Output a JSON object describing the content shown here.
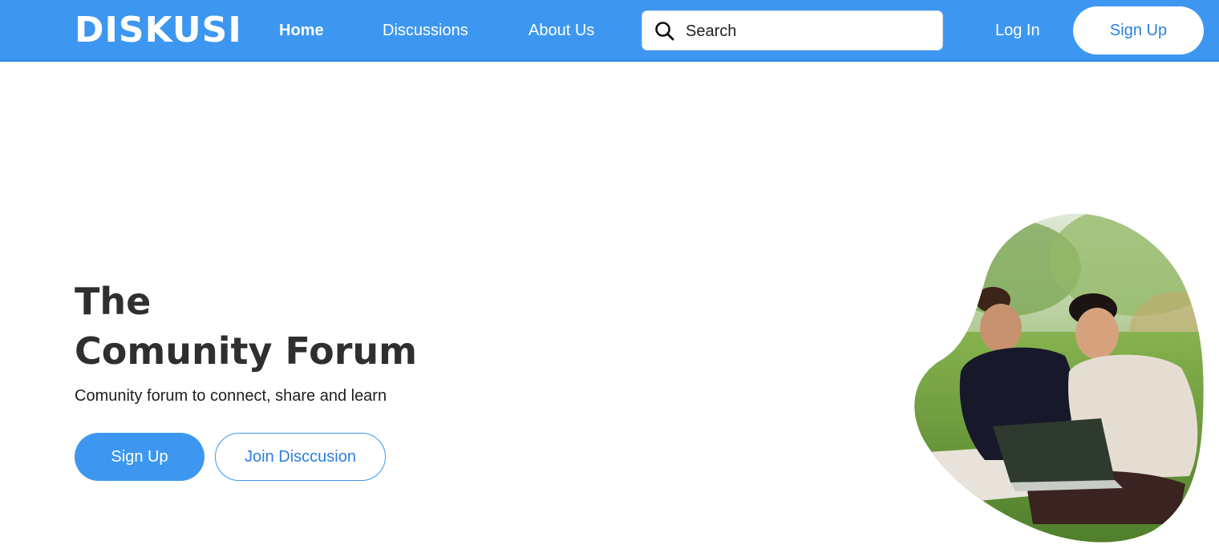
{
  "header": {
    "logo": "DISKUSI",
    "nav": [
      {
        "label": "Home",
        "active": true
      },
      {
        "label": "Discussions",
        "active": false
      },
      {
        "label": "About Us",
        "active": false
      }
    ],
    "search": {
      "placeholder": "Search",
      "value": ""
    },
    "login_label": "Log In",
    "signup_label": "Sign Up"
  },
  "hero": {
    "title_line1": "The",
    "title_line2": "Comunity Forum",
    "subtitle": "Comunity forum to connect, share and learn",
    "primary_button": "Sign Up",
    "secondary_button": "Join Disccusion"
  },
  "colors": {
    "primary": "#3d97f0",
    "header_bg": "#3d97f0",
    "title_text": "#2f2f2f",
    "link_blue": "#2b7fe0"
  },
  "icons": {
    "search": "search-icon"
  }
}
